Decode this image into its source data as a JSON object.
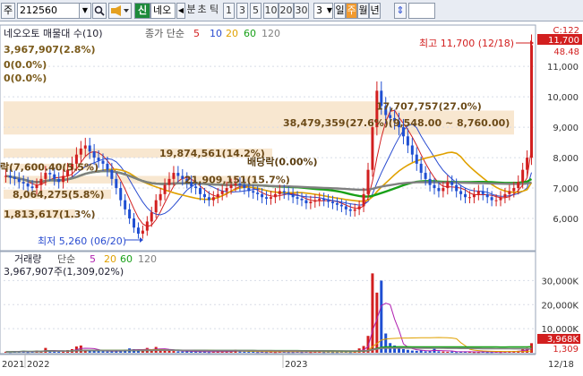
{
  "toolbar": {
    "market_label": "주",
    "code_value": "212560",
    "new_badge": "신",
    "stock_name": "네오",
    "periods": [
      "분",
      "초",
      "틱"
    ],
    "minute_options": [
      "1",
      "3",
      "5",
      "10",
      "20",
      "30"
    ],
    "count_value": "3",
    "day_label": "일",
    "week_label": "주",
    "month_label": "월",
    "year_label": "년"
  },
  "price_panel": {
    "title": "네오오토 매물대 수(10)",
    "ma_title": "종가 단순",
    "ma_periods": [
      "5",
      "10",
      "20",
      "60",
      "120"
    ],
    "ma_colors": [
      "#d21f1f",
      "#2a4cd0",
      "#e0a100",
      "#18a018",
      "#808080"
    ],
    "left_notes": [
      "3,967,907(2.8%)",
      "0(0.0%)",
      "0(0.0%)"
    ],
    "band_labels": [
      {
        "text": "17,707,757(27.0%)",
        "band": 7
      },
      {
        "text": "38,479,359(27.6%)(9,548.00 ~ 8,760.00)",
        "band": 6
      },
      {
        "text": "19,874,561(14.2%)",
        "band": 5
      },
      {
        "text": "락(7,600.40(5.5%)",
        "band": 4
      },
      {
        "text": "21,909,151(15.7%)",
        "band": 3
      },
      {
        "text": "배당락(0.00%)",
        "band": 3
      },
      {
        "text": "8,064,275(5.8%)",
        "band": 2
      },
      {
        "text": "1,813,617(1.3%)",
        "band": 1
      }
    ],
    "high_note": "최고 11,700 (12/18)",
    "low_note": "최저 5,260 (06/20)",
    "y_axis": {
      "min": 5000,
      "max": 12300,
      "ticks": [
        6000,
        7000,
        8000,
        9000,
        10000,
        11000
      ]
    },
    "y_tick_labels": [
      "6,000",
      "7,000",
      "8,000",
      "9,000",
      "10,000",
      "11,000"
    ],
    "current_price_label": "11,700",
    "top_labels": [
      "C:122",
      "48.48"
    ]
  },
  "volume_panel": {
    "title": "거래량",
    "ma_title": "단순",
    "ma_periods": [
      "5",
      "20",
      "60",
      "120"
    ],
    "ma_colors": [
      "#b020b0",
      "#e0a100",
      "#18a018",
      "#808080"
    ],
    "current_volume": "3,967,907주(1,309,02%)",
    "y_axis": {
      "min": 0,
      "max": 35000000,
      "ticks": [
        10000000,
        20000000,
        30000000
      ]
    },
    "y_tick_labels": [
      "10,000K",
      "20,000K",
      "30,000K"
    ],
    "current_label": "3,968K",
    "avg_label": "1,309"
  },
  "x_axis_labels": [
    "2021",
    "2022",
    "2023",
    "12/18"
  ],
  "chart_data": {
    "type": "candlestick",
    "series": [
      {
        "name": "price",
        "values": [
          7400,
          7350,
          7300,
          7200,
          7150,
          7050,
          7000,
          7100,
          7300,
          7500,
          7450,
          7300,
          7200,
          7400,
          7600,
          7800,
          8100,
          8300,
          8400,
          8200,
          8000,
          7900,
          7800,
          7600,
          7300,
          7000,
          6600,
          6300,
          6000,
          5700,
          5500,
          5600,
          5900,
          6200,
          6600,
          6800,
          7100,
          7300,
          7500,
          7400,
          7300,
          7200,
          7050,
          7000,
          6800,
          6700,
          6600,
          6700,
          6800,
          6900,
          7000,
          7100,
          7150,
          7100,
          7000,
          6900,
          6850,
          6800,
          6700,
          6650,
          6700,
          6800,
          6900,
          6850,
          6800,
          6700,
          6650,
          6600,
          6500,
          6550,
          6600,
          6650,
          6600,
          6550,
          6500,
          6450,
          6400,
          6300,
          6250,
          6300,
          6400,
          6800,
          7600,
          9000,
          10200,
          9700,
          9400,
          9300,
          9200,
          9000,
          8700,
          8400,
          8100,
          7800,
          7500,
          7300,
          7100,
          7000,
          6900,
          7000,
          7200,
          7100,
          6900,
          6800,
          6700,
          6700,
          6800,
          6900,
          6800,
          6700,
          6600,
          6600,
          6700,
          6800,
          6900,
          7000,
          7200,
          7600,
          8000,
          11700
        ]
      },
      {
        "name": "volume",
        "values": [
          400000,
          300000,
          600000,
          500000,
          800000,
          300000,
          500000,
          900000,
          700000,
          2000000,
          600000,
          500000,
          400000,
          700000,
          1100000,
          1500000,
          2600000,
          3000000,
          1200000,
          900000,
          800000,
          700000,
          600000,
          500000,
          700000,
          800000,
          900000,
          1300000,
          1800000,
          1500000,
          1100000,
          800000,
          2000000,
          1200000,
          2400000,
          1600000,
          900000,
          800000,
          700000,
          600000,
          500000,
          600000,
          500000,
          400000,
          500000,
          400000,
          300000,
          500000,
          600000,
          500000,
          400000,
          600000,
          1200000,
          500000,
          400000,
          500000,
          400000,
          300000,
          400000,
          300000,
          500000,
          300000,
          400000,
          500000,
          300000,
          300000,
          400000,
          300000,
          600000,
          300000,
          400000,
          500000,
          300000,
          400000,
          300000,
          300000,
          500000,
          400000,
          300000,
          700000,
          1800000,
          2800000,
          7000000,
          33000000,
          25000000,
          30000000,
          8000000,
          4000000,
          3000000,
          2000000,
          1500000,
          1200000,
          900000,
          800000,
          1000000,
          600000,
          700000,
          1800000,
          600000,
          500000,
          400000,
          500000,
          300000,
          400000,
          400000,
          500000,
          300000,
          300000,
          400000,
          300000,
          300000,
          400000,
          300000,
          500000,
          600000,
          700000,
          800000,
          1500000,
          2000000,
          3968000
        ]
      }
    ],
    "ylim": [
      5000,
      12300
    ],
    "xlabel": "",
    "ylabel": ""
  }
}
